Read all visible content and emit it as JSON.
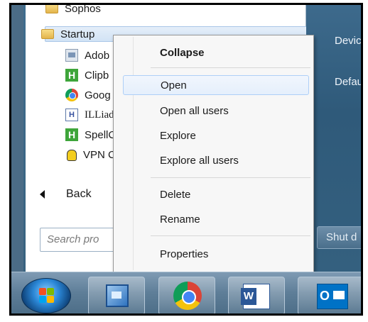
{
  "programs": {
    "sophos_label": "Sophos",
    "startup_label": "Startup",
    "items": [
      {
        "label": "Adob",
        "icon": "adobe-reader-icon"
      },
      {
        "label": "Clipb",
        "icon": "clipboard-h-icon"
      },
      {
        "label": "Goog",
        "icon": "chrome-icon"
      },
      {
        "label": "ILLiad",
        "icon": "illiad-icon"
      },
      {
        "label": "SpellC",
        "icon": "spell-h-icon"
      },
      {
        "label": "VPN C",
        "icon": "vpn-lock-icon"
      }
    ],
    "back_label": "Back"
  },
  "search": {
    "placeholder": "Search pro"
  },
  "right_pane": {
    "devices_label": "Device",
    "defaults_label": "Defaul",
    "shutdown_label": "Shut d"
  },
  "context_menu": {
    "items": [
      "Collapse",
      "Open",
      "Open all users",
      "Explore",
      "Explore all users",
      "Delete",
      "Rename",
      "Properties"
    ],
    "hovered": "Open"
  },
  "taskbar": {
    "apps": [
      "start-orb",
      "remote-desktop-icon",
      "chrome-icon",
      "word-icon",
      "outlook-icon"
    ]
  }
}
